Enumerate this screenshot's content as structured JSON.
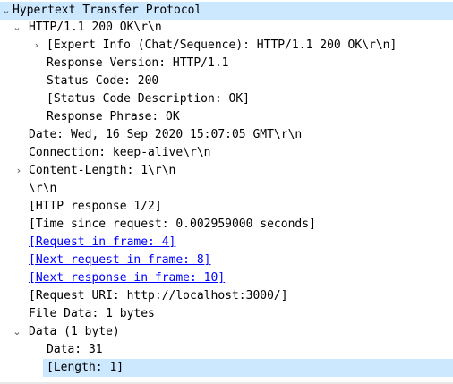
{
  "tree": {
    "rows": [
      {
        "text": "Hypertext Transfer Protocol"
      },
      {
        "text": "HTTP/1.1 200 OK\\r\\n"
      },
      {
        "text": "[Expert Info (Chat/Sequence): HTTP/1.1 200 OK\\r\\n]"
      },
      {
        "text": "Response Version: HTTP/1.1"
      },
      {
        "text": "Status Code: 200"
      },
      {
        "text": "[Status Code Description: OK]"
      },
      {
        "text": "Response Phrase: OK"
      },
      {
        "text": "Date: Wed, 16 Sep 2020 15:07:05 GMT\\r\\n"
      },
      {
        "text": "Connection: keep-alive\\r\\n"
      },
      {
        "text": "Content-Length: 1\\r\\n"
      },
      {
        "text": "\\r\\n"
      },
      {
        "text": "[HTTP response 1/2]"
      },
      {
        "text": "[Time since request: 0.002959000 seconds]"
      },
      {
        "text": "[Request in frame: 4]"
      },
      {
        "text": "[Next request in frame: 8]"
      },
      {
        "text": "[Next response in frame: 10]"
      },
      {
        "text": "[Request URI: http://localhost:3000/]"
      },
      {
        "text": "File Data: 1 bytes"
      },
      {
        "text": "Data (1 byte)"
      },
      {
        "text": "Data: 31"
      },
      {
        "text": "[Length: 1]"
      }
    ]
  },
  "icons": {
    "expanded": "chevron-down-icon",
    "collapsed": "chevron-right-icon"
  },
  "colors": {
    "selection": "#cce8ff",
    "link": "#0000ff"
  }
}
